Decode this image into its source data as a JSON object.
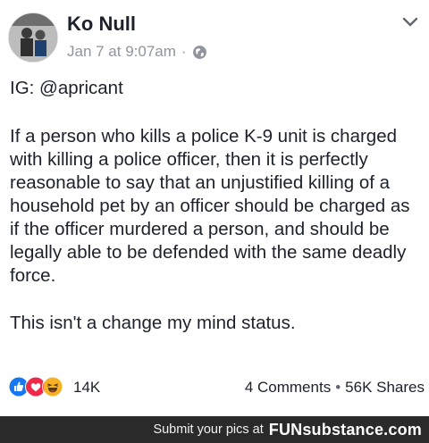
{
  "post": {
    "author": "Ko Null",
    "timestamp": "Jan 7 at 9:07am",
    "separator": "·",
    "privacy_icon": "globe-icon",
    "menu_icon": "chevron-down-icon",
    "lines": {
      "ig": "IG: @apricant",
      "main": "If a person who kills a police K-9 unit is charged with killing a police officer, then it is perfectly reasonable to say that an unjustified killing of a household pet by an officer should be charged as if the officer murdered a person, and should be legally able to be defended with the same deadly force.",
      "closing": "This isn't a change my mind status."
    }
  },
  "footer": {
    "reactions": [
      "like-icon",
      "love-icon",
      "haha-icon"
    ],
    "reaction_count": "14K",
    "comments": "4 Comments",
    "dot": "•",
    "shares": "56K Shares"
  },
  "banner": {
    "text": "Submit your pics at",
    "brand_fun": "FUN",
    "brand_sub": "substance.com"
  },
  "colors": {
    "like": "#1877f2",
    "love": "#f0284a",
    "haha": "#f7b125",
    "meta_gray": "#90949c",
    "banner_bg": "#2a2a2a"
  }
}
